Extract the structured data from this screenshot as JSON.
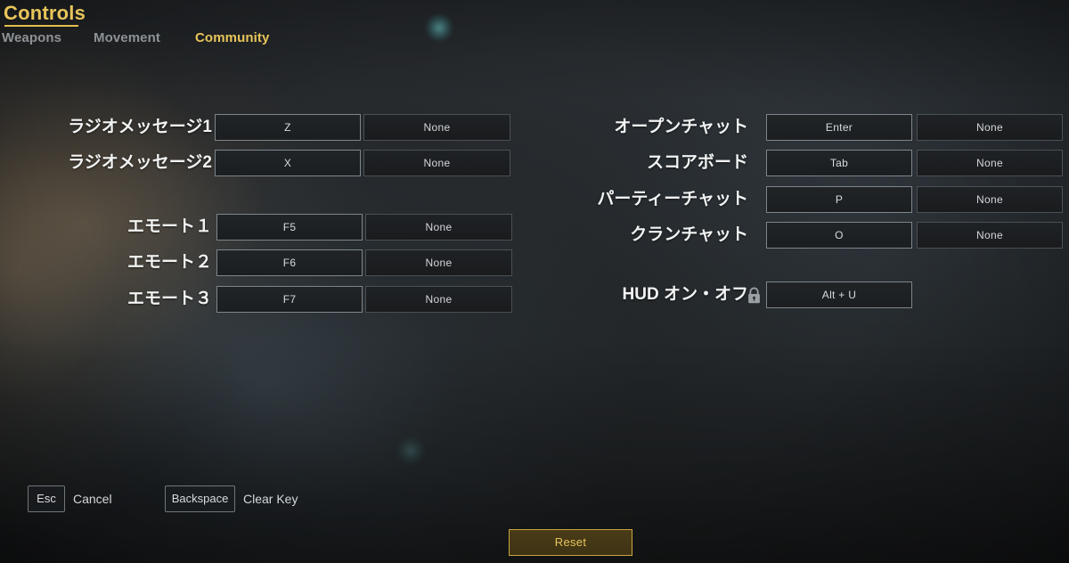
{
  "header": {
    "title": "Controls",
    "tabs": [
      {
        "label": "Weapons",
        "active": false
      },
      {
        "label": "Movement",
        "active": false
      },
      {
        "label": "Community",
        "active": true
      }
    ]
  },
  "accent_color": "#e8c55a",
  "left_column": [
    {
      "label": "ラジオメッセージ1",
      "primary": "Z",
      "secondary": "None"
    },
    {
      "label": "ラジオメッセージ2",
      "primary": "X",
      "secondary": "None"
    },
    {
      "label": "エモート１",
      "primary": "F5",
      "secondary": "None"
    },
    {
      "label": "エモート２",
      "primary": "F6",
      "secondary": "None"
    },
    {
      "label": "エモート３",
      "primary": "F7",
      "secondary": "None"
    }
  ],
  "right_column": [
    {
      "label": "オープンチャット",
      "primary": "Enter",
      "secondary": "None",
      "locked": false
    },
    {
      "label": "スコアボード",
      "primary": "Tab",
      "secondary": "None",
      "locked": false
    },
    {
      "label": "パーティーチャット",
      "primary": "P",
      "secondary": "None",
      "locked": false
    },
    {
      "label": "クランチャット",
      "primary": "O",
      "secondary": "None",
      "locked": false
    },
    {
      "label": "HUD オン・オフ",
      "primary": "Alt + U",
      "secondary": null,
      "locked": true
    }
  ],
  "footer": {
    "hints": [
      {
        "key": "Esc",
        "text": "Cancel"
      },
      {
        "key": "Backspace",
        "text": "Clear Key"
      }
    ],
    "reset_label": "Reset"
  }
}
